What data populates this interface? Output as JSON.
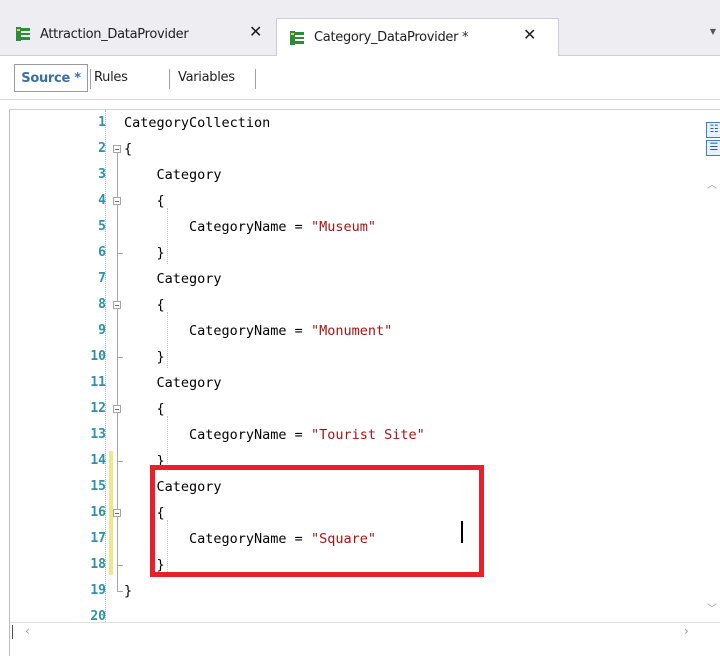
{
  "tabs": [
    {
      "label": "Attraction_DataProvider",
      "close": "✕",
      "icon": "data-provider-icon"
    },
    {
      "label": "Category_DataProvider *",
      "close": "✕",
      "icon": "data-provider-icon"
    }
  ],
  "subtabs": {
    "source": "Source *",
    "rules": "Rules",
    "variables": "Variables"
  },
  "editor": {
    "lines": [
      {
        "n": "1",
        "text": "CategoryCollection"
      },
      {
        "n": "2",
        "text": "{"
      },
      {
        "n": "3",
        "text": "    Category"
      },
      {
        "n": "4",
        "text": "    {"
      },
      {
        "n": "5",
        "code": "        CategoryName = ",
        "str": "\"Museum\""
      },
      {
        "n": "6",
        "text": "    }"
      },
      {
        "n": "7",
        "text": "    Category"
      },
      {
        "n": "8",
        "text": "    {"
      },
      {
        "n": "9",
        "code": "        CategoryName = ",
        "str": "\"Monument\""
      },
      {
        "n": "10",
        "text": "    }"
      },
      {
        "n": "11",
        "text": "    Category"
      },
      {
        "n": "12",
        "text": "    {"
      },
      {
        "n": "13",
        "code": "        CategoryName = ",
        "str": "\"Tourist Site\""
      },
      {
        "n": "14",
        "text": "    }"
      },
      {
        "n": "15",
        "text": "    Category"
      },
      {
        "n": "16",
        "text": "    {"
      },
      {
        "n": "17",
        "code": "        CategoryName = ",
        "str": "\"Square\""
      },
      {
        "n": "18",
        "text": "    }"
      },
      {
        "n": "19",
        "text": "}"
      },
      {
        "n": "20",
        "text": ""
      }
    ]
  },
  "colors": {
    "line_number": "#2b91af",
    "string": "#a31515",
    "highlight_box": "#e8202a"
  }
}
